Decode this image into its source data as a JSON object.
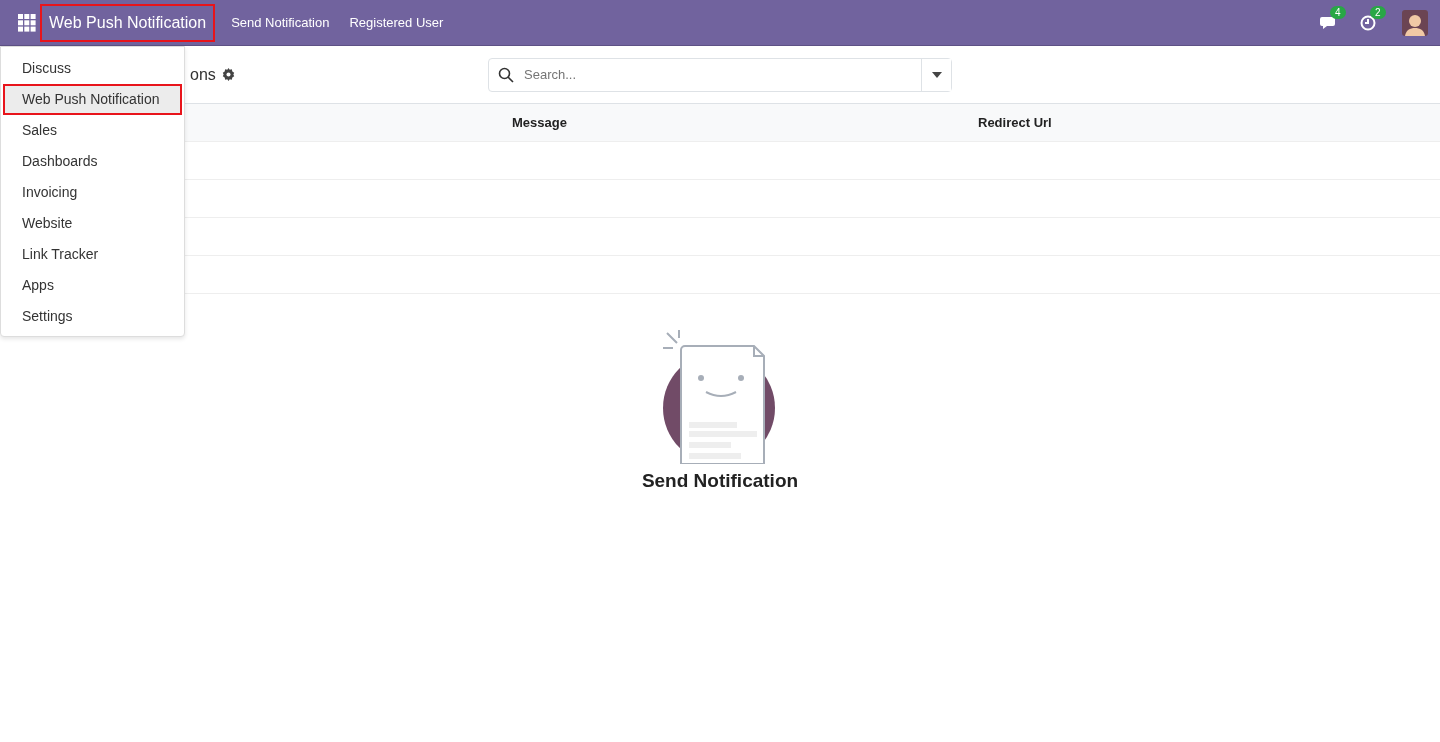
{
  "navbar": {
    "brand": {
      "label": "Web Push Notification",
      "highlighted": true
    },
    "menu": [
      {
        "label": "Send Notification"
      },
      {
        "label": "Registered User"
      }
    ],
    "systray": [
      {
        "kind": "chat",
        "badge": "4"
      },
      {
        "kind": "activity",
        "badge": "2"
      }
    ]
  },
  "app_menu": [
    {
      "label": "Discuss",
      "highlighted": false
    },
    {
      "label": "Web Push Notification",
      "highlighted": true
    },
    {
      "label": "Sales",
      "highlighted": false
    },
    {
      "label": "Dashboards",
      "highlighted": false
    },
    {
      "label": "Invoicing",
      "highlighted": false
    },
    {
      "label": "Website",
      "highlighted": false
    },
    {
      "label": "Link Tracker",
      "highlighted": false
    },
    {
      "label": "Apps",
      "highlighted": false
    },
    {
      "label": "Settings",
      "highlighted": false
    }
  ],
  "control_panel": {
    "title": "ons",
    "search": {
      "placeholder": "Search..."
    }
  },
  "table": {
    "columns": [
      {
        "label": "Message"
      },
      {
        "label": "Redirect Url"
      }
    ]
  },
  "empty_state": {
    "title": "Send Notification"
  }
}
